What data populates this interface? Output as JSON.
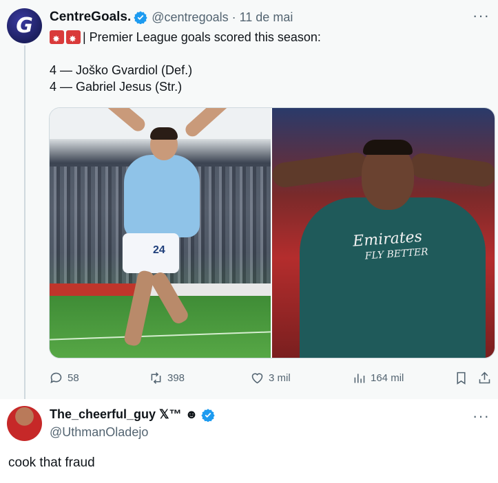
{
  "tweet": {
    "author_name": "CentreGoals.",
    "avatar_letter": "G",
    "handle": "@centregoals",
    "separator": "·",
    "date": "11 de mai",
    "more": "···",
    "line1": "| Premier League goals scored this season:",
    "line2": "4 — Joško Gvardiol (Def.)",
    "line3": "4 — Gabriel Jesus (Str.)",
    "emoji_icons": [
      "siren-icon",
      "siren-icon"
    ],
    "media": {
      "left_shirt_number": "24",
      "right_sponsor_line1": "Emirates",
      "right_sponsor_line2": "FLY BETTER"
    },
    "actions": {
      "replies": "58",
      "retweets": "398",
      "likes": "3 mil",
      "views": "164 mil"
    }
  },
  "reply": {
    "name": "The_cheerful_guy 𝕏™ ☻",
    "handle": "@UthmanOladejo",
    "more": "···",
    "text": "cook that fraud"
  },
  "colors": {
    "verified_blue": "#1d9bf0",
    "muted_text": "#536471",
    "background_top": "#f7f9f9"
  }
}
